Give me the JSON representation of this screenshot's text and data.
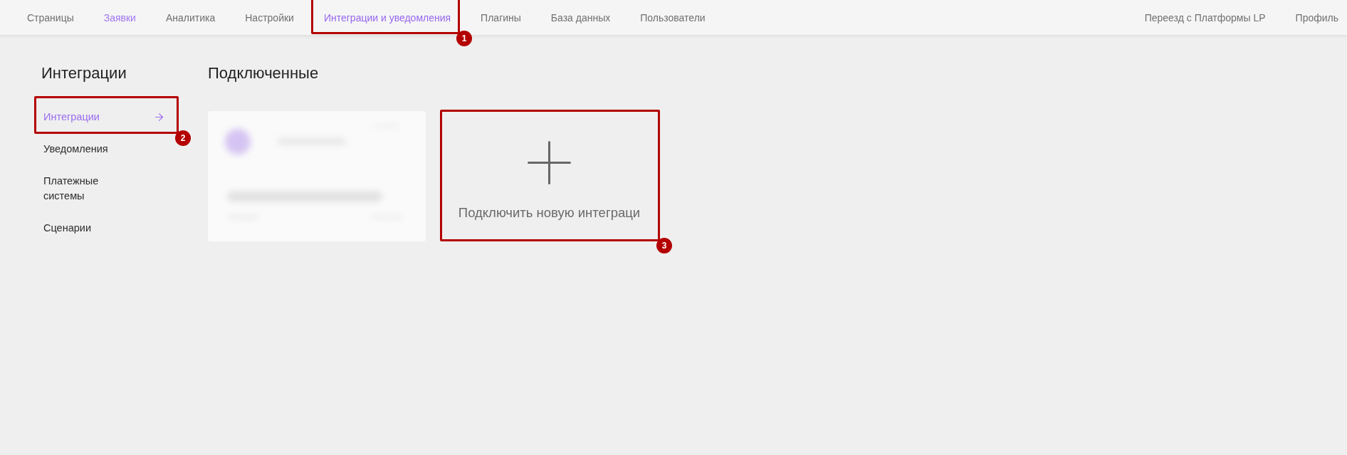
{
  "nav": {
    "items": [
      {
        "label": "Страницы",
        "selected": false,
        "highlighted": false
      },
      {
        "label": "Заявки",
        "selected": false,
        "highlighted": true
      },
      {
        "label": "Аналитика",
        "selected": false,
        "highlighted": false
      },
      {
        "label": "Настройки",
        "selected": false,
        "highlighted": false
      },
      {
        "label": "Интеграции и уведомления",
        "selected": true,
        "highlighted": false,
        "callout": "1"
      },
      {
        "label": "Плагины",
        "selected": false,
        "highlighted": false
      },
      {
        "label": "База данных",
        "selected": false,
        "highlighted": false
      },
      {
        "label": "Пользователи",
        "selected": false,
        "highlighted": false
      }
    ],
    "right_items": [
      "Переезд с Платформы LP",
      "Профиль"
    ]
  },
  "sidebar": {
    "title": "Интеграции",
    "items": [
      {
        "label": "Интеграции",
        "selected": true,
        "callout": "2"
      },
      {
        "label": "Уведомления",
        "selected": false
      },
      {
        "label": "Платежные системы",
        "selected": false
      },
      {
        "label": "Сценарии",
        "selected": false
      }
    ]
  },
  "content": {
    "title": "Подключенные",
    "cards": [
      {
        "kind": "blurred"
      },
      {
        "kind": "add",
        "label": "Подключить новую интеграци",
        "callout": "3"
      }
    ]
  }
}
